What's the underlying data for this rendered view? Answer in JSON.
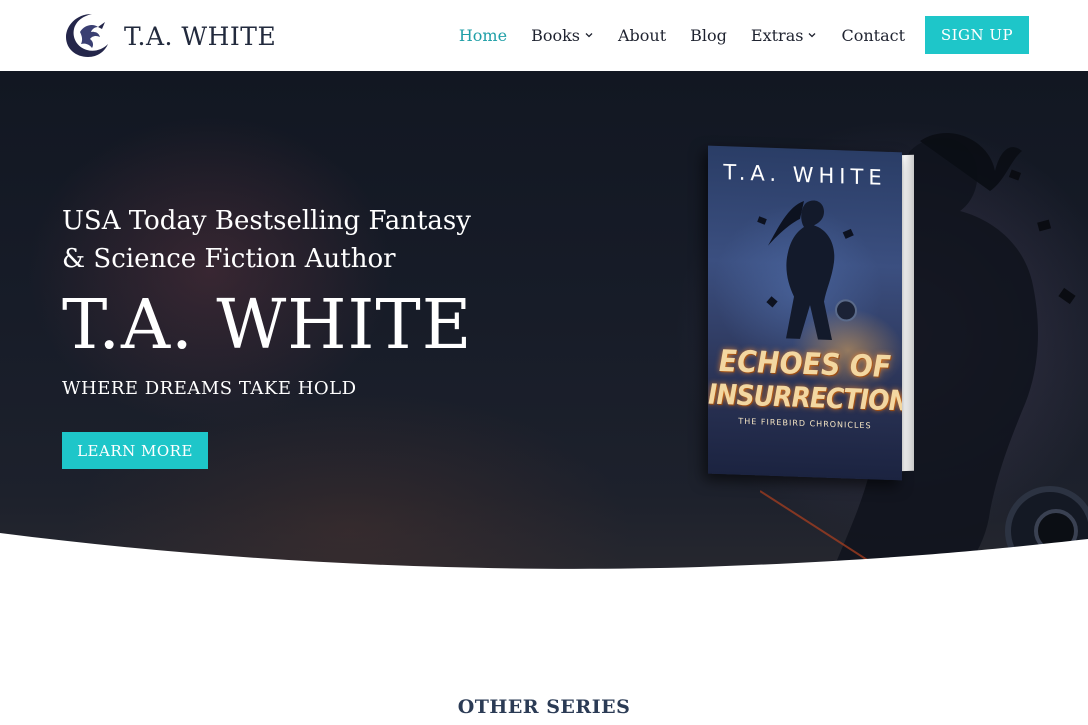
{
  "header": {
    "logo_text": "T.A. WHITE",
    "nav": [
      {
        "label": "Home",
        "active": true,
        "dropdown": false
      },
      {
        "label": "Books",
        "active": false,
        "dropdown": true
      },
      {
        "label": "About",
        "active": false,
        "dropdown": false
      },
      {
        "label": "Blog",
        "active": false,
        "dropdown": false
      },
      {
        "label": "Extras",
        "active": false,
        "dropdown": true
      },
      {
        "label": "Contact",
        "active": false,
        "dropdown": false
      }
    ],
    "signup_label": "SIGN UP"
  },
  "hero": {
    "tagline": "USA Today Bestselling Fantasy & Science Fiction Author",
    "name": "T.A. WHITE",
    "subtitle": "WHERE DREAMS TAKE HOLD",
    "cta_label": "LEARN MORE"
  },
  "book": {
    "author": "T.A. WHITE",
    "title_line1": "ECHOES OF",
    "title_line2": "INSURRECTION",
    "series": "THE FIREBIRD CHRONICLES"
  },
  "sections": {
    "other_series_title": "OTHER SERIES"
  },
  "colors": {
    "accent": "#1ec6c9",
    "active_nav": "#1f9fa7",
    "text_dark": "#1f2330",
    "hero_bg": "#151a25"
  },
  "icons": {
    "logo": "dragon-crescent-icon",
    "dropdown": "chevron-down-icon"
  }
}
